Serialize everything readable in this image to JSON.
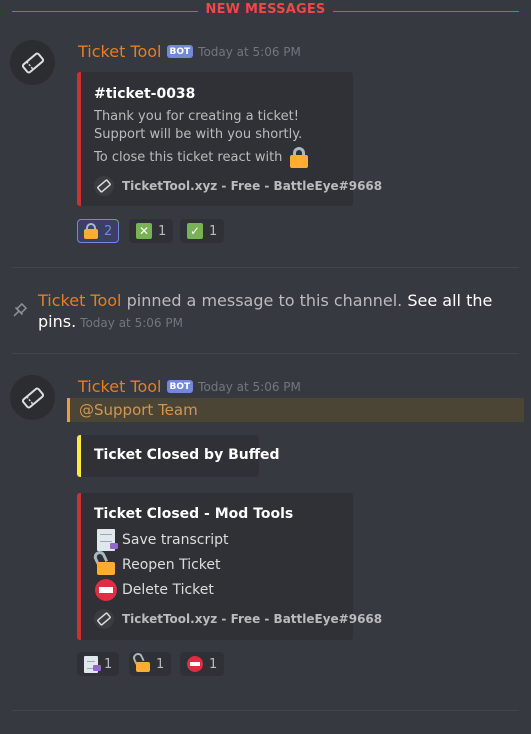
{
  "new_messages_label": "NEW MESSAGES",
  "message1": {
    "username": "Ticket Tool",
    "bot_tag": "BOT",
    "timestamp": "Today at 5:06 PM",
    "embed": {
      "title": "#ticket-0038",
      "line1": "Thank you for creating a ticket!",
      "line2": "Support will be with you shortly.",
      "line3": "To close this ticket react with",
      "footer": "TicketTool.xyz - Free - BattleEye#9668"
    },
    "reactions": [
      {
        "emoji": "lock-icon",
        "count": "2"
      },
      {
        "emoji": "x-box-icon",
        "count": "1"
      },
      {
        "emoji": "check-box-icon",
        "count": "1"
      }
    ]
  },
  "system_message": {
    "user": "Ticket Tool",
    "text": " pinned a message to this channel. ",
    "link": "See all the pins.",
    "timestamp": "Today at 5:06 PM"
  },
  "message2": {
    "username": "Ticket Tool",
    "bot_tag": "BOT",
    "timestamp": "Today at 5:06 PM",
    "mention": "@Support Team",
    "closed_embed": {
      "title": "Ticket Closed by Buffed"
    },
    "tools_embed": {
      "title": "Ticket Closed - Mod Tools",
      "actions": [
        "Save transcript",
        "Reopen Ticket",
        "Delete Ticket"
      ],
      "footer": "TicketTool.xyz - Free - BattleEye#9668"
    },
    "reactions": [
      {
        "emoji": "page-icon",
        "count": "1"
      },
      {
        "emoji": "unlock-icon",
        "count": "1"
      },
      {
        "emoji": "no-entry-icon",
        "count": "1"
      }
    ]
  },
  "colors": {
    "background": "#36393f",
    "embed_bg": "#2f3136",
    "username": "#e67e22",
    "new_messages": "#f04747",
    "embed_red": "#d32f2f",
    "embed_yellow": "#ffeb3b",
    "bot_tag": "#7289da"
  }
}
